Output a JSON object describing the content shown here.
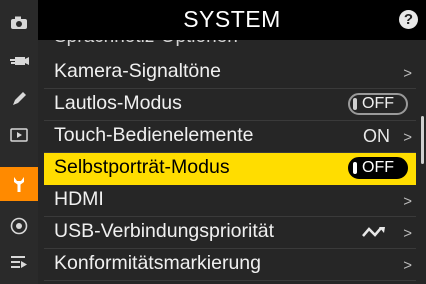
{
  "header": {
    "title": "SYSTEM",
    "help_label": "?"
  },
  "sidebar": {
    "items": [
      {
        "icon": "camera-icon",
        "active": false
      },
      {
        "icon": "movie-camera-icon",
        "active": false
      },
      {
        "icon": "pencil-icon",
        "active": false
      },
      {
        "icon": "playback-icon",
        "active": false
      },
      {
        "icon": "wrench-icon",
        "active": true
      },
      {
        "icon": "network-icon",
        "active": false
      },
      {
        "icon": "my-menu-icon",
        "active": false
      }
    ]
  },
  "menu": {
    "partial_item": "Sprachnotiz-Optionen",
    "items": [
      {
        "label": "Kamera-Signaltöne",
        "value": ""
      },
      {
        "label": "Lautlos-Modus",
        "value": "OFF"
      },
      {
        "label": "Touch-Bedienelemente",
        "value": "ON"
      },
      {
        "label": "Selbstporträt-Modus",
        "value": "OFF"
      },
      {
        "label": "HDMI",
        "value": ""
      },
      {
        "label": "USB-Verbindungspriorität",
        "value": ""
      },
      {
        "label": "Konformitätsmarkierung",
        "value": ""
      }
    ]
  },
  "colors": {
    "accent": "#ffdd00",
    "sidebar_active": "#ff8a00",
    "list_bg": "#262626"
  }
}
